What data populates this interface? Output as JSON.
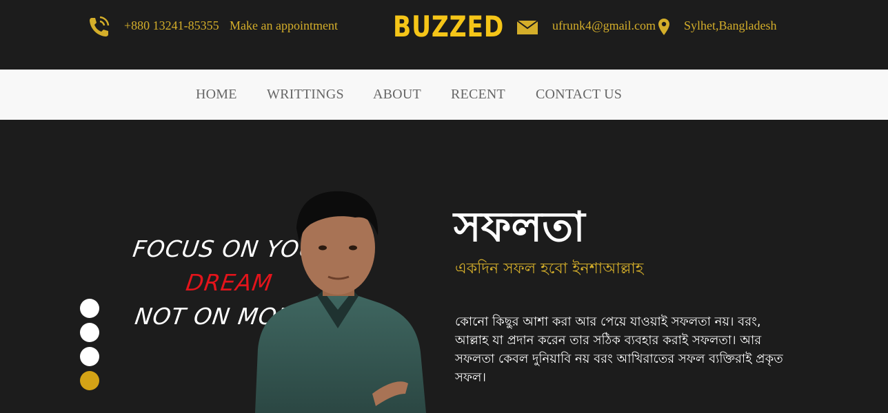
{
  "topbar": {
    "phone": "+880 13241-85355",
    "appointment": "Make an appointment",
    "brand": "BUZZED",
    "email": "ufrunk4@gmail.com",
    "location": "Sylhet,Bangladesh",
    "icons": [
      "phone-icon",
      "envelope-icon",
      "map-pin-icon"
    ],
    "accent_color": "#d4ae2a"
  },
  "nav": {
    "items": [
      "HOME",
      "WRITTINGS",
      "ABOUT",
      "RECENT",
      "CONTACT US"
    ]
  },
  "hero": {
    "quote": {
      "line1": "FOCUS ON YOUR",
      "line2": "DREAM",
      "line3": "NOT ON MONEY"
    },
    "title": "সফলতা",
    "subtitle": "একদিন সফল হবো ইনশাআল্লাহ",
    "body": "কোনো কিছুর আশা করা আর পেয়ে যাওয়াই সফলতা নয়। বরং, আল্লাহ যা প্রদান করেন তার সঠিক ব্যবহার করাই সফলতা। আর সফলতা কেবল দুনিয়াবি নয় বরং আখিরাতের সফল ব্যক্তিরাই প্রকৃত সফল।",
    "slider": {
      "count": 4,
      "active_index": 3
    },
    "colors": {
      "background": "#1c1c1c",
      "accent": "#d4a316",
      "quote_red": "#e3141b"
    }
  }
}
